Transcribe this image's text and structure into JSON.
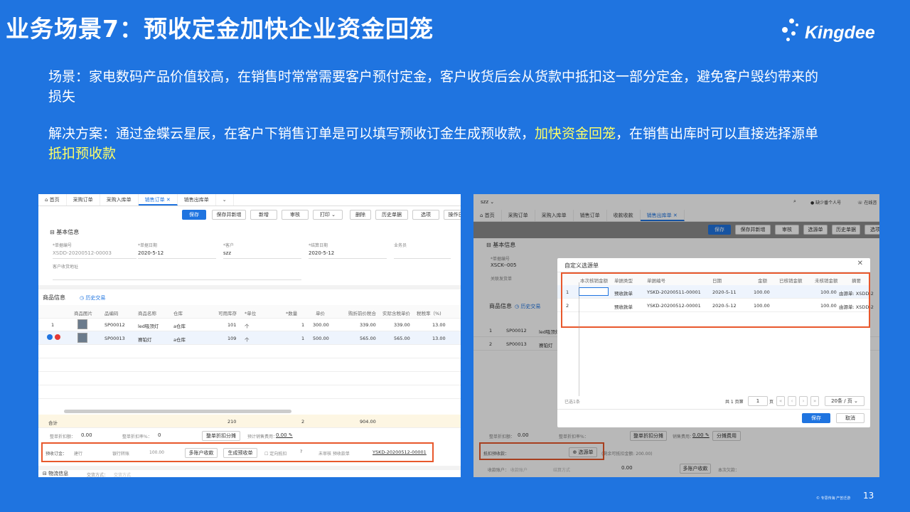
{
  "slide": {
    "title": "业务场景7：预收定金加快企业资金回笼",
    "logo_text": "Kingdee",
    "scenario": "场景：家电数码产品价值较高，在销售时常常需要客户预付定金，客户收货后会从货款中抵扣这一部分定金，避免客户毁约带来的损失",
    "solution_prefix": "解决方案：通过金蝶云星辰，在客户下销售订单是可以填写预收订金生成预收款，",
    "solution_hl1": "加快资金回笼",
    "solution_mid": "，在销售出库时可以直接选择源单",
    "solution_hl2": "抵扣预收款",
    "footer": "© 专思传海 产苦迁游",
    "page_number": "13"
  },
  "colors": {
    "background": "#1f74e0",
    "highlight": "#ffff66",
    "accent": "#1f74e0",
    "callout": "#e8582c"
  },
  "left": {
    "tabs": [
      "首页",
      "采购订单",
      "采购入库单",
      "销售订单",
      "销售出库单"
    ],
    "active_tab": "销售订单",
    "toolbar": [
      "保存",
      "保存并新增",
      "新增",
      "审核",
      "打印",
      "删除",
      "历史单据",
      "选项",
      "操作日"
    ],
    "section_basic": "基本信息",
    "fields": {
      "no_label": "*单据编号",
      "no_value": "XSDD-20200512-00003",
      "date_label": "*单据日期",
      "date_value": "2020-5-12",
      "customer_label": "*客户",
      "customer_value": "szz",
      "settle_label": "*结算日期",
      "settle_value": "2020-5-12",
      "sales_label": "业务员",
      "addr_label": "客户收货地址"
    },
    "section_goods": "商品信息",
    "history_link": "历史交易",
    "columns": [
      "商品图片",
      "品编码",
      "商品名称",
      "仓库",
      "可用库存",
      "*单位",
      "*数量",
      "单价",
      "购折前价税合",
      "实际含税单价",
      "税税率（%)"
    ],
    "rows": [
      {
        "idx": "1",
        "code": "SP00012",
        "name": "led吸顶灯",
        "wh": "a仓库",
        "stock": "101",
        "unit": "个",
        "qty": "1",
        "price": "300.00",
        "amount": "339.00",
        "real": "339.00",
        "tax": "13.00"
      },
      {
        "idx": "",
        "code": "SP00013",
        "name": "赛铂灯",
        "wh": "a仓库",
        "stock": "109",
        "unit": "个",
        "qty": "1",
        "price": "500.00",
        "amount": "565.00",
        "real": "565.00",
        "tax": "13.00"
      }
    ],
    "total_label": "合计",
    "total_stock": "210",
    "total_qty": "2",
    "total_amount": "904.00",
    "discount_label": "整单折扣额：",
    "discount_value": "0.00",
    "rate_label": "整单折扣率%：",
    "rate_value": "0",
    "split_btn": "整单折扣分摊",
    "fee_label": "预计销售费用：",
    "fee_value": "0.00",
    "deposit_label": "预收订金：",
    "deposit_account": "建行",
    "deposit_method": "银行转账",
    "deposit_amount": "100.00",
    "multi_btn": "多账户收款",
    "gen_btn": "生成预收单",
    "auto_label": "定向抵扣",
    "receipt_status": "未审核 预收款单",
    "receipt_no": "YSKD-20200512-00001",
    "logistics": "物流信息",
    "ship_label": "交货方式：",
    "ship_placeholder": "交货方式"
  },
  "right": {
    "app": "szz",
    "topbar": [
      "缺少番个人号",
      "在线咨"
    ],
    "tabs": [
      "首页",
      "采购订单",
      "采购入库单",
      "销售订单",
      "收款收款",
      "销售出库单"
    ],
    "toolbar": [
      "保存",
      "保存并新增",
      "审核",
      "选源单",
      "历史单据",
      "选项"
    ],
    "section_basic": "基本信息",
    "no_label": "*单据编号",
    "no_value": "XSCK--005",
    "rel_label": "关联发货单",
    "section_goods": "商品信息",
    "history_link": "历史交易",
    "bg_rows": [
      {
        "idx": "1",
        "code": "SP00012",
        "name": "led吸顶灯"
      },
      {
        "idx": "2",
        "code": "SP00013",
        "name": "赛铂灯"
      }
    ],
    "dialog": {
      "title": "自定义选源单",
      "columns": [
        "本次核销金额",
        "单据类型",
        "单据编号",
        "日期",
        "金额",
        "已核销金额",
        "未核销金额",
        "摘要"
      ],
      "rows": [
        {
          "idx": "1",
          "type": "预收款单",
          "no": "YSKD-20200511-00001",
          "date": "2020-5-11",
          "amount": "100.00",
          "unpaid": "100.00",
          "memo": "由源单: XSDD-2"
        },
        {
          "idx": "2",
          "type": "预收款单",
          "no": "YSKD-20200512-00001",
          "date": "2020-5-12",
          "amount": "100.00",
          "unpaid": "100.00",
          "memo": "由源单: XSDD-2"
        }
      ],
      "selected": "已选1条",
      "pager": "共 1 页第",
      "page": "1",
      "page_suffix": "页",
      "page_size": "20条 / 页",
      "save": "保存",
      "cancel": "取消"
    },
    "discount_label": "整单折扣额：",
    "discount_value": "0.00",
    "rate_label": "整单折扣率%：",
    "split_btn": "整单折扣分摊",
    "fee_label": "销售费用：",
    "fee_value": "0.00",
    "fee_btn": "分摊费用",
    "offset_label": "抵扣预收款：",
    "select_btn": "选源单",
    "remain": "(剩余可抵扣金额: 200.00)",
    "receive_label": "收款账户：",
    "receive_ph": "收款账户",
    "method_ph": "结算方式",
    "receive_val": "0.00",
    "multi_btn": "多账户收款",
    "owed_label": "本次欠款："
  }
}
